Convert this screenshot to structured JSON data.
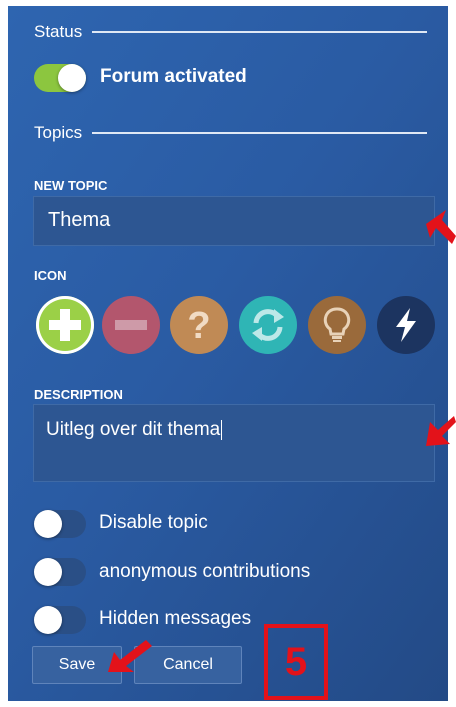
{
  "status": {
    "heading": "Status",
    "forum_toggle_label": "Forum activated",
    "forum_toggle_on": true
  },
  "topics": {
    "heading": "Topics"
  },
  "new_topic": {
    "label": "NEW TOPIC",
    "value": "Thema"
  },
  "icon": {
    "label": "ICON",
    "options": [
      {
        "name": "plus-icon",
        "color": "#9bd047",
        "selected": true
      },
      {
        "name": "minus-icon",
        "color": "#b3566d"
      },
      {
        "name": "question-icon",
        "color": "#c08a55"
      },
      {
        "name": "refresh-icon",
        "color": "#2fb5b5"
      },
      {
        "name": "lightbulb-icon",
        "color": "#9a6a3b"
      },
      {
        "name": "lightning-icon",
        "color": "#1c3460"
      }
    ]
  },
  "description": {
    "label": "DESCRIPTION",
    "value": "Uitleg over dit thema"
  },
  "options": [
    {
      "label": "Disable topic",
      "on": false
    },
    {
      "label": "anonymous contributions",
      "on": false
    },
    {
      "label": "Hidden messages",
      "on": false
    }
  ],
  "buttons": {
    "save": "Save",
    "cancel": "Cancel"
  },
  "annotation": {
    "step_number": "5",
    "color": "#e3121a"
  }
}
